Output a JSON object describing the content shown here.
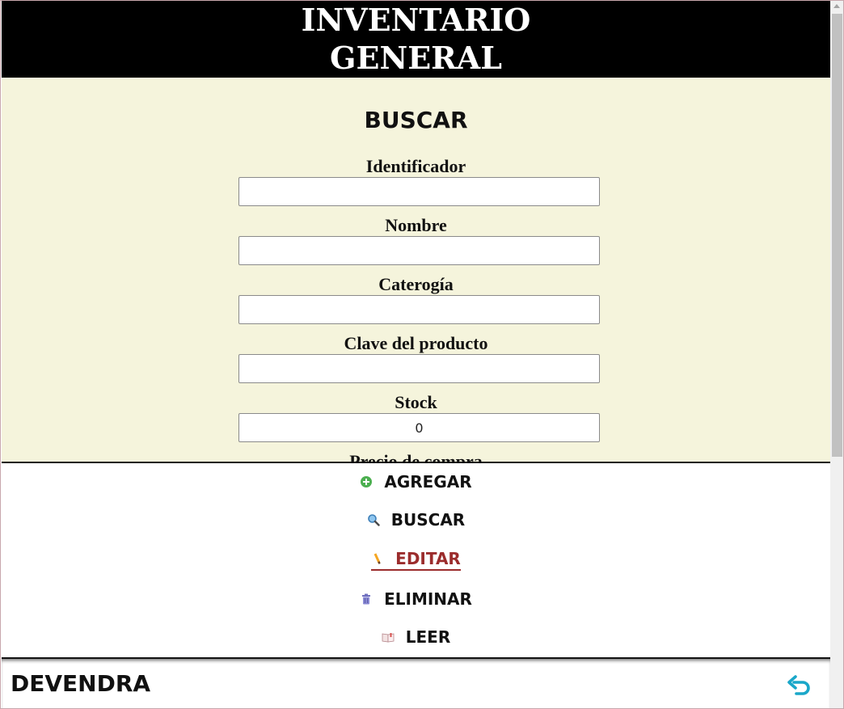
{
  "header": {
    "title_line1": "INVENTARIO",
    "title_line2": "GENERAL"
  },
  "form": {
    "title": "BUSCAR",
    "fields": [
      {
        "label": "Identificador",
        "value": ""
      },
      {
        "label": "Nombre",
        "value": ""
      },
      {
        "label": "Caterogía",
        "value": ""
      },
      {
        "label": "Clave del producto",
        "value": ""
      },
      {
        "label": "Stock",
        "value": "0"
      },
      {
        "label": "Precio de compra"
      }
    ]
  },
  "menu": {
    "items": [
      {
        "label": "AGREGAR",
        "icon": "plus-circle-icon"
      },
      {
        "label": "BUSCAR",
        "icon": "magnifier-icon"
      },
      {
        "label": "EDITAR",
        "icon": "pencil-icon",
        "active": true
      },
      {
        "label": "ELIMINAR",
        "icon": "trash-icon"
      },
      {
        "label": "LEER",
        "icon": "book-icon"
      }
    ]
  },
  "footer": {
    "brand": "DEVENDRA",
    "back_icon": "undo-arrow-icon"
  },
  "colors": {
    "header_bg": "#000000",
    "panel_bg": "#f5f4dc",
    "active_item": "#9b2c2c",
    "back_icon": "#1aa7c9"
  }
}
